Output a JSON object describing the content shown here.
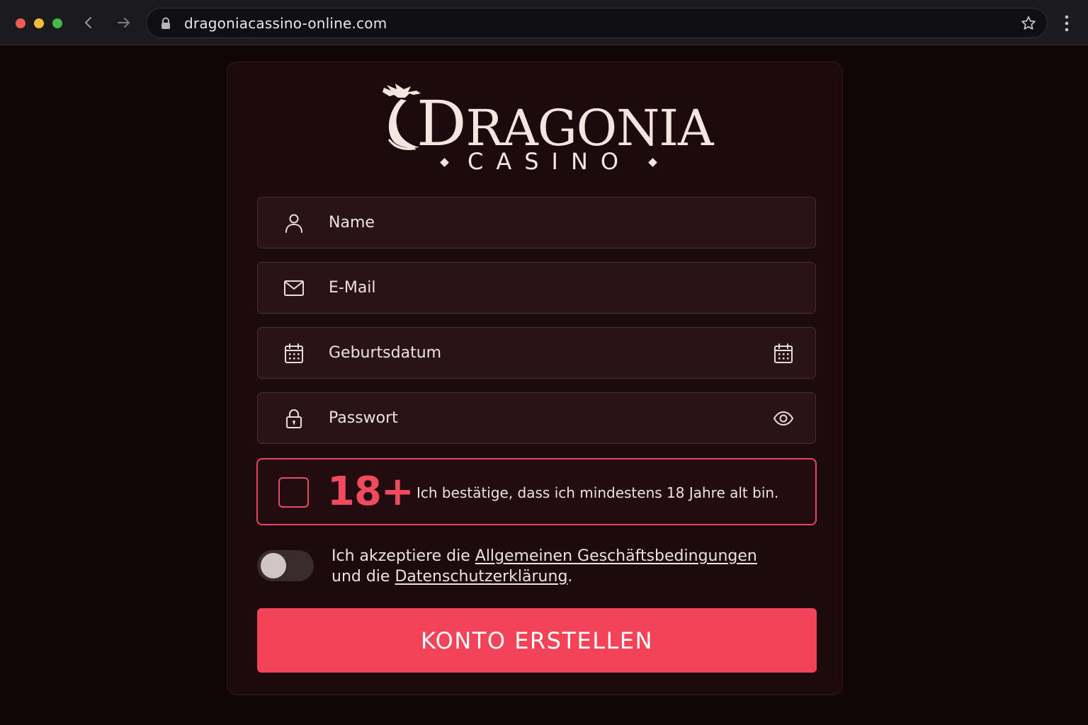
{
  "browser": {
    "url": "dragoniacassino-online.com",
    "icons": [
      "chevron-left-icon",
      "arrow-right-icon",
      "lock-icon",
      "star-icon",
      "more-vertical-icon"
    ]
  },
  "logo": {
    "title_initial": "D",
    "title_rest": "RAGONIA",
    "subtitle": "CASINO"
  },
  "form": {
    "name_placeholder": "Name",
    "email_placeholder": "E-Mail",
    "birthdate_placeholder": "Geburtsdatum",
    "password_placeholder": "Passwort",
    "age_badge": "18+",
    "age_confirm_text": "Ich bestätige, dass ich mindestens 18 Jahre alt bin.",
    "age_checked": false,
    "terms_prefix": "Ich akzeptiere die ",
    "terms_link": "Allgemeinen Geschäftsbedingungen",
    "terms_middle": "und die ",
    "privacy_link": "Datenschutzerklärung",
    "terms_suffix": ".",
    "terms_accepted": false,
    "submit_label": "KONTO ERSTELLEN"
  },
  "colors": {
    "background": "#120508",
    "card": "#1c0a0f",
    "field": "#2a1219",
    "accent": "#f24359",
    "text": "#ece2e3"
  }
}
